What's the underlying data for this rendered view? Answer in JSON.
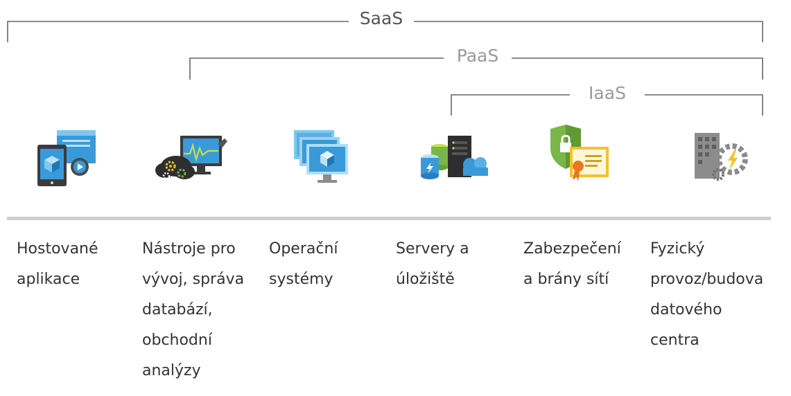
{
  "layers": [
    {
      "id": "saas",
      "label": "SaaS"
    },
    {
      "id": "paas",
      "label": "PaaS"
    },
    {
      "id": "iaas",
      "label": "IaaS"
    }
  ],
  "columns": [
    {
      "icon": "hosted-app-icon",
      "label": "Hostované\naplikace"
    },
    {
      "icon": "dev-tools-icon",
      "label": "Nástroje pro\nvývoj, správa\ndatabází,\nobchodní\nanalýzy"
    },
    {
      "icon": "operating-systems-icon",
      "label": "Operační\nsystémy"
    },
    {
      "icon": "servers-storage-icon",
      "label": "Servery a\núložiště"
    },
    {
      "icon": "security-certificate-icon",
      "label": "Zabezpečení\na brány sítí"
    },
    {
      "icon": "datacenter-building-icon",
      "label": "Fyzický\nprovoz/budova\ndatového\ncentra"
    }
  ],
  "colors": {
    "accent_blue": "#3a9ad9",
    "light_blue": "#7ec8f0",
    "dark_gray": "#3b3b3b",
    "green": "#7ab648",
    "yellow": "#f2c12e",
    "orange": "#e87722"
  }
}
